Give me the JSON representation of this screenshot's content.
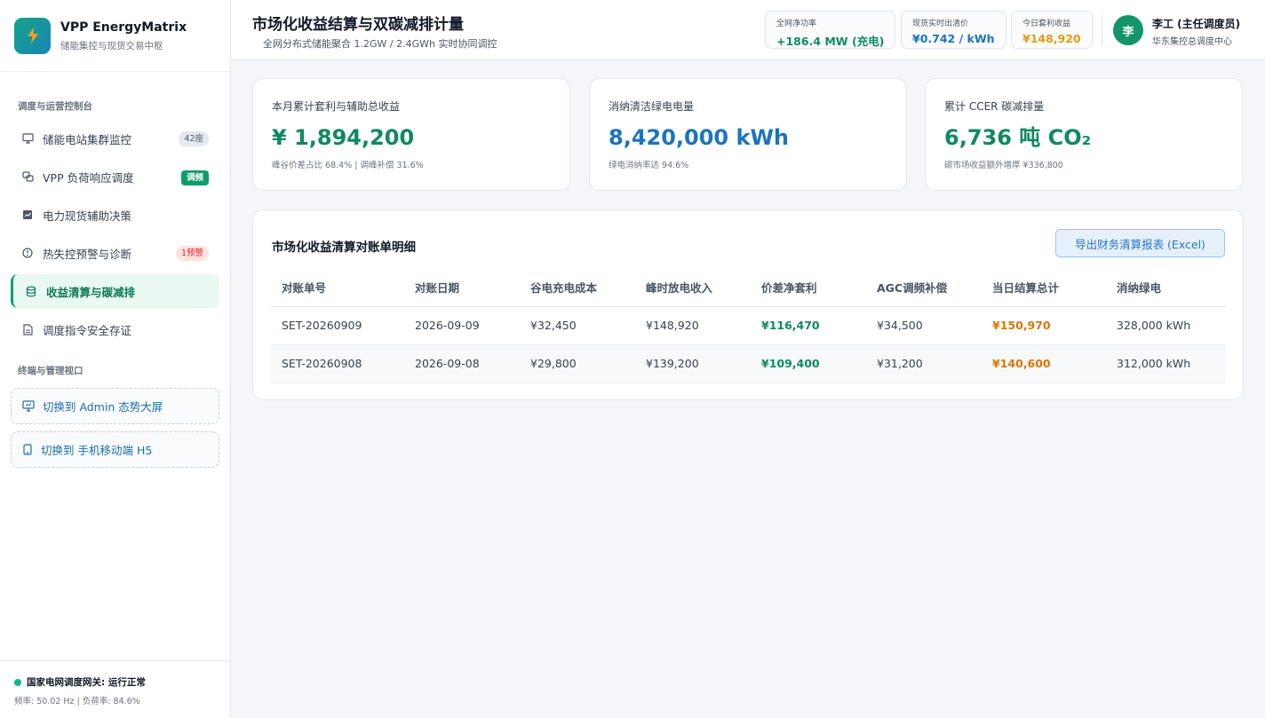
{
  "brand": {
    "title": "VPP EnergyMatrix",
    "subtitle": "储能集控与现货交易中枢",
    "logo_icon": "lightning-icon"
  },
  "sidebar": {
    "section1": "调度与运营控制台",
    "items": [
      {
        "label": "储能电站集群监控",
        "icon": "monitor-icon",
        "badge": "42座"
      },
      {
        "label": "VPP 负荷响应调度",
        "icon": "link-icon",
        "badge": "调频"
      },
      {
        "label": "电力现货辅助决策",
        "icon": "chart-icon"
      },
      {
        "label": "热失控预警与诊断",
        "icon": "alert-icon",
        "badge": "1预警"
      },
      {
        "label": "收益清算与碳减排",
        "icon": "database-icon"
      },
      {
        "label": "调度指令安全存证",
        "icon": "document-icon"
      }
    ],
    "section2": "终端与管理视口",
    "switches": [
      {
        "label": "切换到 Admin 态势大屏",
        "icon": "screen-icon"
      },
      {
        "label": "切换到 手机移动端 H5",
        "icon": "phone-icon"
      }
    ],
    "footer": {
      "status": "国家电网调度网关: 运行正常",
      "meta": "频率: 50.02 Hz | 负荷率: 84.6%"
    }
  },
  "header": {
    "title": "市场化收益结算与双碳减排计量",
    "subtitle": "全网分布式储能聚合 1.2GW / 2.4GWh 实时协同调控",
    "stats": [
      {
        "label": "全网净功率",
        "value": "+186.4 MW (充电)",
        "color": "#0f8a5f"
      },
      {
        "label": "现货实时出清价",
        "value": "¥0.742 / kWh",
        "color": "#1b74c0"
      },
      {
        "label": "今日套利收益",
        "value": "¥148,920",
        "color": "#e39b12"
      }
    ],
    "user": {
      "avatar": "李",
      "name": "李工 (主任调度员)",
      "org": "华东集控总调度中心"
    }
  },
  "kpis": [
    {
      "label": "本月累计套利与辅助总收益",
      "value": "¥ 1,894,200",
      "note": "峰谷价差占比 68.4% | 调峰补偿 31.6%",
      "color": "#0f8a5f"
    },
    {
      "label": "消纳清洁绿电电量",
      "value": "8,420,000 kWh",
      "note": "绿电消纳率达 94.6%",
      "color": "#1b74c0"
    },
    {
      "label": "累计 CCER 碳减排量",
      "value": "6,736 吨 CO₂",
      "note": "碳市场收益额外增厚 ¥336,800",
      "color": "#0f8a5f"
    }
  ],
  "ledger": {
    "title": "市场化收益清算对账单明细",
    "export_label": "导出财务清算报表 (Excel)",
    "columns": [
      "对账单号",
      "对账日期",
      "谷电充电成本",
      "峰时放电收入",
      "价差净套利",
      "AGC调频补偿",
      "当日结算总计",
      "消纳绿电"
    ],
    "rows": [
      [
        "SET-20260909",
        "2026-09-09",
        "¥32,450",
        "¥148,920",
        "¥116,470",
        "¥34,500",
        "¥150,970",
        "328,000 kWh"
      ],
      [
        "SET-20260908",
        "2026-09-08",
        "¥29,800",
        "¥139,200",
        "¥109,400",
        "¥31,200",
        "¥140,600",
        "312,000 kWh"
      ]
    ]
  }
}
